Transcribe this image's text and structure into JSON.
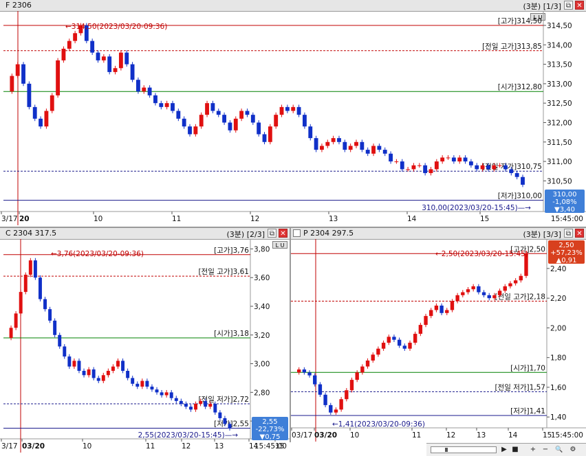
{
  "panels": [
    {
      "id": "f",
      "title": "F 2306",
      "period": "(3분)",
      "page": "[1/3]",
      "ylabels": [
        "314,50",
        "314,00",
        "313,50",
        "313,00",
        "312,50",
        "312,00",
        "311,50",
        "311,00",
        "310,50"
      ],
      "yvalues": [
        314.5,
        314.0,
        313.5,
        313.0,
        312.5,
        312.0,
        311.5,
        311.0,
        310.5
      ],
      "ymin": 309.8,
      "ymax": 314.8,
      "xlabels": [
        "3/17",
        "20",
        "10",
        "11",
        "12",
        "13",
        "14",
        "15"
      ],
      "time_end": "15:45:00",
      "levels": [
        {
          "label": "[고가]314,50",
          "value": 314.5,
          "color": "#c00000",
          "dash": false
        },
        {
          "label": "[전일 고가]313,85",
          "value": 313.85,
          "color": "#c00000",
          "dash": true
        },
        {
          "label": "[시가]312,80",
          "value": 312.8,
          "color": "#008000",
          "dash": false
        },
        {
          "label": "[전일 저가]310,75",
          "value": 310.75,
          "color": "#1a1a8c",
          "dash": true
        },
        {
          "label": "[저가]310,00",
          "value": 310.0,
          "color": "#1a1a8c",
          "dash": false
        }
      ],
      "high_note": "314,50(2023/03/20-09:36)",
      "last_note": "310,00(2023/03/20-15:45)",
      "badge": {
        "price": "310,00",
        "pct": "-1,08%",
        "chg": "▼3,40",
        "color": "#3f7fd8"
      },
      "series": [
        312.8,
        313.2,
        313.5,
        313.0,
        312.4,
        312.1,
        311.9,
        312.3,
        312.7,
        313.6,
        313.9,
        314.1,
        314.3,
        314.5,
        314.1,
        313.8,
        313.6,
        313.7,
        313.3,
        313.4,
        313.8,
        313.5,
        313.1,
        312.8,
        312.9,
        312.7,
        312.5,
        312.4,
        312.5,
        312.3,
        312.1,
        311.9,
        311.7,
        311.9,
        312.2,
        312.5,
        312.3,
        312.2,
        312.0,
        311.8,
        312.1,
        312.3,
        312.2,
        312.0,
        311.7,
        311.5,
        311.9,
        312.2,
        312.4,
        312.3,
        312.4,
        312.2,
        311.9,
        311.6,
        311.3,
        311.4,
        311.5,
        311.6,
        311.5,
        311.3,
        311.4,
        311.5,
        311.3,
        311.2,
        311.4,
        311.3,
        311.2,
        311.0,
        311.0,
        310.8,
        310.8,
        310.9,
        310.9,
        310.7,
        310.8,
        311.0,
        311.1,
        311.1,
        311.0,
        311.1,
        311.0,
        310.9,
        310.8,
        310.9,
        310.8,
        310.9,
        310.9,
        310.8,
        310.7,
        310.6,
        310.4
      ]
    },
    {
      "id": "c",
      "title": "C 2304 317.5",
      "period": "(3분)",
      "page": "[2/3]",
      "ylabels": [
        "3,80",
        "3,60",
        "3,40",
        "3,20",
        "3,00",
        "2,80",
        "2,60"
      ],
      "yvalues": [
        3.8,
        3.6,
        3.4,
        3.2,
        3.0,
        2.8,
        2.6
      ],
      "ymin": 2.5,
      "ymax": 3.85,
      "xlabels": [
        "3/17",
        "03/20",
        "10",
        "11",
        "12",
        "13",
        "14",
        "15"
      ],
      "time_end": "15:45:00",
      "levels": [
        {
          "label": "[고가]3,76",
          "value": 3.76,
          "color": "#c00000",
          "dash": false
        },
        {
          "label": "[전일 고가]3,61",
          "value": 3.61,
          "color": "#c00000",
          "dash": true
        },
        {
          "label": "[시가]3,18",
          "value": 3.18,
          "color": "#008000",
          "dash": false
        },
        {
          "label": "[전일 저가]2,72",
          "value": 2.72,
          "color": "#1a1a8c",
          "dash": true
        },
        {
          "label": "[저가]2,55",
          "value": 2.55,
          "color": "#1a1a8c",
          "dash": false
        }
      ],
      "high_note": "3,76(2023/03/20-09:36)",
      "last_note": "2,55(2023/03/20-15:45)",
      "badge": {
        "price": "2,55",
        "pct": "-22,73%",
        "chg": "▼0,75",
        "color": "#3f7fd8"
      },
      "series": [
        3.18,
        3.25,
        3.35,
        3.5,
        3.62,
        3.72,
        3.6,
        3.45,
        3.38,
        3.3,
        3.2,
        3.12,
        3.05,
        2.98,
        3.02,
        2.95,
        2.92,
        2.96,
        2.9,
        2.88,
        2.92,
        2.95,
        2.98,
        3.02,
        2.95,
        2.9,
        2.86,
        2.84,
        2.88,
        2.84,
        2.82,
        2.8,
        2.78,
        2.8,
        2.76,
        2.74,
        2.72,
        2.7,
        2.68,
        2.72,
        2.74,
        2.7,
        2.72,
        2.66,
        2.62,
        2.58,
        2.55
      ]
    },
    {
      "id": "p",
      "title": "P 2304 297.5",
      "period": "(3분)",
      "page": "[3/3]",
      "ylabels": [
        "2,40",
        "2,20",
        "2,00",
        "1,80",
        "1,60",
        "1,40"
      ],
      "yvalues": [
        2.4,
        2.2,
        2.0,
        1.8,
        1.6,
        1.4
      ],
      "ymin": 1.35,
      "ymax": 2.58,
      "xlabels": [
        "03/17",
        "03/20",
        "10",
        "11",
        "12",
        "13",
        "14",
        "15"
      ],
      "time_end": "15:45:00",
      "levels": [
        {
          "label": "[고가]2,50",
          "value": 2.5,
          "color": "#c00000",
          "dash": false
        },
        {
          "label": "[전일 고가]2,18",
          "value": 2.18,
          "color": "#c00000",
          "dash": true
        },
        {
          "label": "[시가]1,70",
          "value": 1.7,
          "color": "#008000",
          "dash": false
        },
        {
          "label": "[전일 저가]1,57",
          "value": 1.57,
          "color": "#1a1a8c",
          "dash": true
        },
        {
          "label": "[저가]1,41",
          "value": 1.41,
          "color": "#1a1a8c",
          "dash": false
        }
      ],
      "high_note": "2,50(2023/03/20-15:45)",
      "low_note": "1,41(2023/03/20-09:36)",
      "badge": {
        "price": "2,50",
        "pct": "+57,23%",
        "chg": "▲0,91",
        "color": "#d8401e"
      },
      "series": [
        1.7,
        1.72,
        1.7,
        1.68,
        1.62,
        1.55,
        1.48,
        1.43,
        1.45,
        1.52,
        1.58,
        1.65,
        1.7,
        1.74,
        1.78,
        1.82,
        1.86,
        1.9,
        1.94,
        1.92,
        1.88,
        1.86,
        1.9,
        1.96,
        2.02,
        2.08,
        2.12,
        2.15,
        2.1,
        2.12,
        2.18,
        2.22,
        2.24,
        2.26,
        2.28,
        2.24,
        2.22,
        2.2,
        2.22,
        2.25,
        2.28,
        2.3,
        2.32,
        2.35,
        2.5
      ]
    }
  ],
  "scrollbar": {
    "zoom_in": "+",
    "zoom_out": "−",
    "search": "🔍",
    "play": "▶",
    "stop": "■"
  }
}
